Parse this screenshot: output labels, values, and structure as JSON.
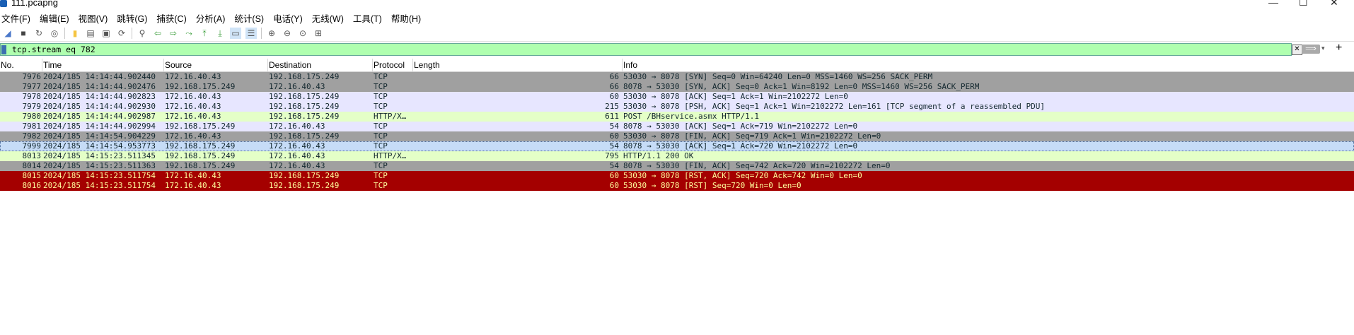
{
  "window": {
    "title": "111.pcapng",
    "minimize": "—",
    "maximize": "☐",
    "close": "✕"
  },
  "menu": [
    "文件(F)",
    "编辑(E)",
    "视图(V)",
    "跳转(G)",
    "捕获(C)",
    "分析(A)",
    "统计(S)",
    "电话(Y)",
    "无线(W)",
    "工具(T)",
    "帮助(H)"
  ],
  "toolbar": {
    "icons": [
      "shark-fin-start-icon",
      "stop-icon",
      "restart-icon",
      "options-gear-icon",
      "open-folder-icon",
      "save-icon",
      "close-file-icon",
      "reload-icon",
      "find-icon",
      "back-arrow-icon",
      "forward-arrow-icon",
      "goto-packet-icon",
      "first-packet-icon",
      "last-packet-icon",
      "autoscroll-icon",
      "colorize-icon",
      "zoom-in-icon",
      "zoom-out-icon",
      "zoom-reset-icon",
      "resize-columns-icon"
    ],
    "glyphs": [
      "◢",
      "■",
      "↻",
      "◎",
      "▮",
      "▤",
      "▣",
      "⟳",
      "⚲",
      "⇦",
      "⇨",
      "⤳",
      "⤒",
      "⤓",
      "▭",
      "☰",
      "⊕",
      "⊖",
      "⊙",
      "⊞"
    ],
    "colors": {
      "start": "#4a77c9",
      "stop": "#444444",
      "folder": "#f5c542",
      "arrow": "#3fa03f"
    }
  },
  "filter": {
    "value": "tcp.stream eq 782",
    "clear": "✕",
    "apply": "⟹",
    "dropdown": "▾",
    "add": "+",
    "background": "#afffaf"
  },
  "columns": {
    "no": "No.",
    "time": "Time",
    "source": "Source",
    "destination": "Destination",
    "protocol": "Protocol",
    "length": "Length",
    "info": "Info"
  },
  "packets": [
    {
      "no": "7976",
      "time": "2024/185 14:14:44.902440",
      "src": "172.16.40.43",
      "dst": "192.168.175.249",
      "proto": "TCP",
      "len": "66",
      "info": "53030 → 8078 [SYN] Seq=0 Win=64240 Len=0 MSS=1460 WS=256 SACK_PERM",
      "bg": "#a0a0a0",
      "fg": "#12272e"
    },
    {
      "no": "7977",
      "time": "2024/185 14:14:44.902476",
      "src": "192.168.175.249",
      "dst": "172.16.40.43",
      "proto": "TCP",
      "len": "66",
      "info": "8078 → 53030 [SYN, ACK] Seq=0 Ack=1 Win=8192 Len=0 MSS=1460 WS=256 SACK_PERM",
      "bg": "#a0a0a0",
      "fg": "#12272e"
    },
    {
      "no": "7978",
      "time": "2024/185 14:14:44.902823",
      "src": "172.16.40.43",
      "dst": "192.168.175.249",
      "proto": "TCP",
      "len": "60",
      "info": "53030 → 8078 [ACK] Seq=1 Ack=1 Win=2102272 Len=0",
      "bg": "#e7e6ff",
      "fg": "#12272e"
    },
    {
      "no": "7979",
      "time": "2024/185 14:14:44.902930",
      "src": "172.16.40.43",
      "dst": "192.168.175.249",
      "proto": "TCP",
      "len": "215",
      "info": "53030 → 8078 [PSH, ACK] Seq=1 Ack=1 Win=2102272 Len=161 [TCP segment of a reassembled PDU]",
      "bg": "#e7e6ff",
      "fg": "#12272e"
    },
    {
      "no": "7980",
      "time": "2024/185 14:14:44.902987",
      "src": "172.16.40.43",
      "dst": "192.168.175.249",
      "proto": "HTTP/X…",
      "len": "611",
      "info": "POST /BHservice.asmx HTTP/1.1",
      "bg": "#e4ffc7",
      "fg": "#12272e"
    },
    {
      "no": "7981",
      "time": "2024/185 14:14:44.902994",
      "src": "192.168.175.249",
      "dst": "172.16.40.43",
      "proto": "TCP",
      "len": "54",
      "info": "8078 → 53030 [ACK] Seq=1 Ack=719 Win=2102272 Len=0",
      "bg": "#e7e6ff",
      "fg": "#12272e"
    },
    {
      "no": "7982",
      "time": "2024/185 14:14:54.904229",
      "src": "172.16.40.43",
      "dst": "192.168.175.249",
      "proto": "TCP",
      "len": "60",
      "info": "53030 → 8078 [FIN, ACK] Seq=719 Ack=1 Win=2102272 Len=0",
      "bg": "#a0a0a0",
      "fg": "#12272e"
    },
    {
      "no": "7999",
      "time": "2024/185 14:14:54.953773",
      "src": "192.168.175.249",
      "dst": "172.16.40.43",
      "proto": "TCP",
      "len": "54",
      "info": "8078 → 53030 [ACK] Seq=1 Ack=720 Win=2102272 Len=0",
      "bg": "#c6dcf7",
      "fg": "#12272e",
      "selected": true
    },
    {
      "no": "8013",
      "time": "2024/185 14:15:23.511345",
      "src": "192.168.175.249",
      "dst": "172.16.40.43",
      "proto": "HTTP/X…",
      "len": "795",
      "info": "HTTP/1.1 200 OK",
      "bg": "#e4ffc7",
      "fg": "#12272e"
    },
    {
      "no": "8014",
      "time": "2024/185 14:15:23.511363",
      "src": "192.168.175.249",
      "dst": "172.16.40.43",
      "proto": "TCP",
      "len": "54",
      "info": "8078 → 53030 [FIN, ACK] Seq=742 Ack=720 Win=2102272 Len=0",
      "bg": "#a0a0a0",
      "fg": "#12272e"
    },
    {
      "no": "8015",
      "time": "2024/185 14:15:23.511754",
      "src": "172.16.40.43",
      "dst": "192.168.175.249",
      "proto": "TCP",
      "len": "60",
      "info": "53030 → 8078 [RST, ACK] Seq=720 Ack=742 Win=0 Len=0",
      "bg": "#a40000",
      "fg": "#fffc9c"
    },
    {
      "no": "8016",
      "time": "2024/185 14:15:23.511754",
      "src": "172.16.40.43",
      "dst": "192.168.175.249",
      "proto": "TCP",
      "len": "60",
      "info": "53030 → 8078 [RST] Seq=720 Win=0 Len=0",
      "bg": "#a40000",
      "fg": "#fffc9c"
    }
  ]
}
